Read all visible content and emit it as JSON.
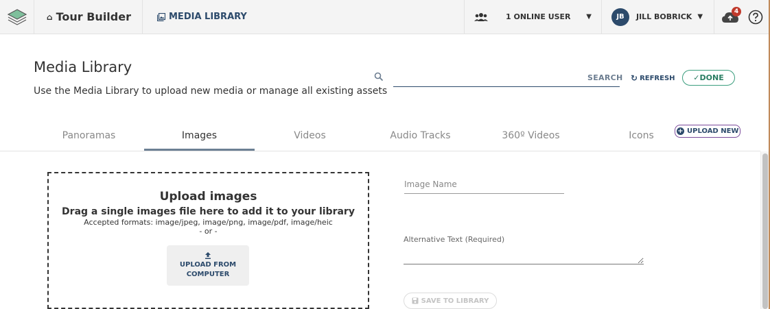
{
  "topbar": {
    "app_title": "Tour Builder",
    "section": "MEDIA LIBRARY",
    "online_users": "1 ONLINE USER",
    "user_initials": "JB",
    "user_name": "JILL BOBRICK",
    "notification_count": "4"
  },
  "header": {
    "title": "Media Library",
    "subtitle": "Use the Media Library to upload new media or manage all existing assets",
    "search": {
      "placeholder": "",
      "button_label": "SEARCH"
    },
    "refresh_label": "REFRESH",
    "done_label": "DONE"
  },
  "tabs": [
    {
      "label": "Panoramas",
      "active": false
    },
    {
      "label": "Images",
      "active": true
    },
    {
      "label": "Videos",
      "active": false
    },
    {
      "label": "Audio Tracks",
      "active": false
    },
    {
      "label": "360º Videos",
      "active": false
    },
    {
      "label": "Icons",
      "active": false
    }
  ],
  "upload_new_label": "UPLOAD NEW",
  "dropzone": {
    "title": "Upload images",
    "drag_text": "Drag a single images file here to add it to your library",
    "formats": "Accepted formats: image/jpeg, image/png, image/pdf, image/heic",
    "or_text": "- or -",
    "upload_line1": "UPLOAD FROM",
    "upload_line2": "COMPUTER"
  },
  "form": {
    "image_name_placeholder": "Image Name",
    "alt_text_label": "Alternative Text (Required)",
    "save_label": "SAVE TO LIBRARY"
  },
  "colors": {
    "brand": "#2c4a6b",
    "done_green": "#3a9d7d",
    "badge_red": "#c0392b",
    "upload_new_border": "#7b4a9b"
  },
  "icons": {
    "logo": "layers-logo-icon",
    "home": "home-icon",
    "media": "image-library-icon",
    "users": "users-group-icon",
    "cloud": "cloud-upload-icon",
    "help": "help-circle-icon",
    "search": "search-icon",
    "refresh": "refresh-icon",
    "done": "check-icon",
    "upload": "upload-arrow-icon",
    "save": "save-disk-icon"
  }
}
